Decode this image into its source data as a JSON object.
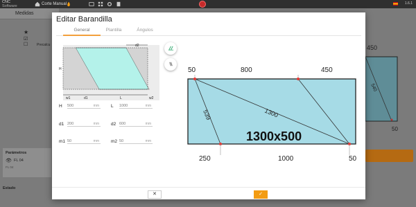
{
  "topbar": {
    "brand_line1": "CNC",
    "brand_line2": "Software",
    "menu_label": "Corte Manual",
    "version": "1.6.1"
  },
  "background": {
    "tab_label": "Medidas",
    "left_label": "Precalcu",
    "params_title": "Parámetros",
    "params_item": "FL 04",
    "params_sub": "FL 04",
    "state_title": "Estado",
    "right_val_top": "450",
    "right_val_diag": "540",
    "right_val_bottom": "50"
  },
  "dialog": {
    "title": "Editar Barandilla",
    "tabs": [
      "General",
      "Plantilla",
      "Ángulos"
    ],
    "mini_labels": {
      "d2": "d2",
      "H": "H",
      "w1": "w1",
      "d1": "d1",
      "L": "L",
      "w2": "w2"
    },
    "fields": {
      "H": {
        "label": "H",
        "value": "500",
        "unit": "mm"
      },
      "L": {
        "label": "L",
        "value": "1000",
        "unit": "mm"
      },
      "d1": {
        "label": "d1",
        "value": "200",
        "unit": "mm"
      },
      "d2": {
        "label": "d2",
        "value": "600",
        "unit": "mm"
      },
      "m1": {
        "label": "m1",
        "value": "50",
        "unit": "mm"
      },
      "m2": {
        "label": "m2",
        "value": "50",
        "unit": "mm"
      }
    },
    "drawing": {
      "top_left": "50",
      "top_mid": "800",
      "top_right": "450",
      "diag_left": "539",
      "diag_mid": "1300",
      "size_label": "1300x500",
      "bottom_left": "250",
      "bottom_mid": "1000",
      "bottom_right": "50"
    },
    "buttons": {
      "cancel": "✕",
      "ok": "✓"
    }
  },
  "colors": {
    "accent": "#f39c12",
    "fill": "#a6dbe6",
    "mini_fill": "#b4f2ea",
    "point": "#e53935"
  }
}
